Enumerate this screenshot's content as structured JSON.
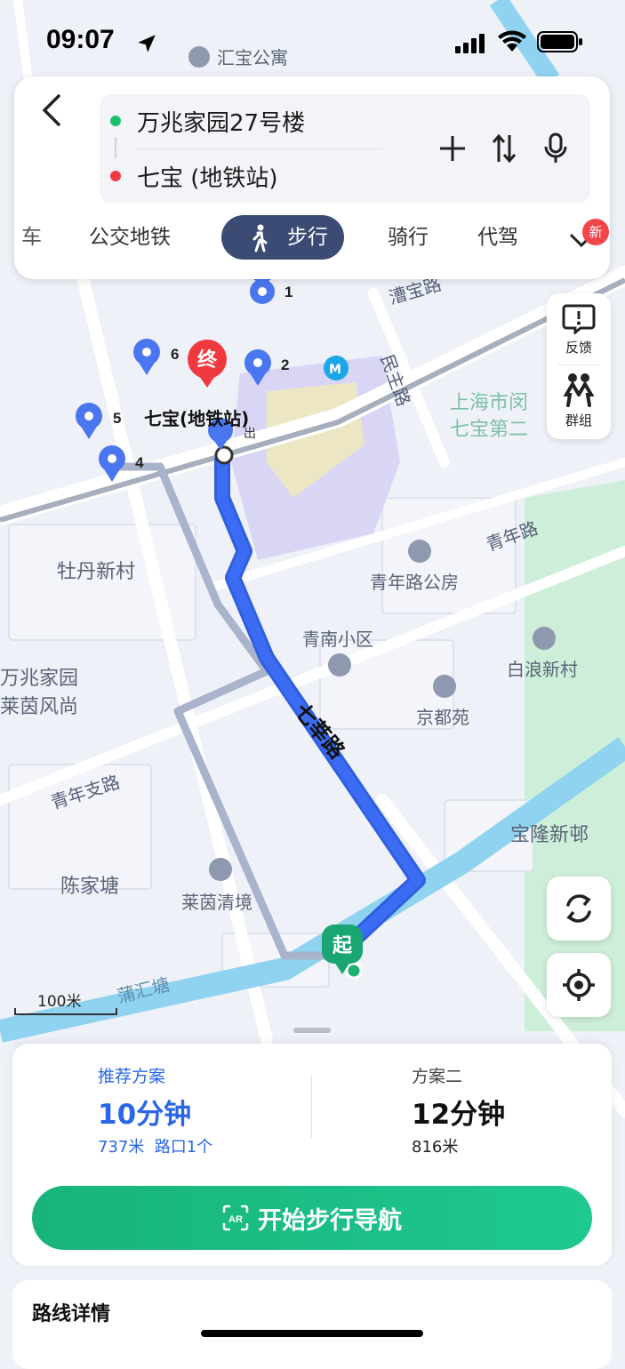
{
  "status_bar": {
    "time": "09:07"
  },
  "route": {
    "origin": "万兆家园27号楼",
    "destination": "七宝 (地铁站)"
  },
  "tabs": [
    "车",
    "公交地铁",
    "步行",
    "骑行",
    "代驾"
  ],
  "new_badge": "新",
  "side_panel": {
    "feedback": "反馈",
    "group": "群组"
  },
  "map": {
    "labels": {
      "huibao": "汇宝公寓",
      "caobao_road": "漕宝路",
      "minzhu_road": "民主路",
      "school1": "上海市闵",
      "school2": "七宝第二",
      "station": "七宝(地铁站)",
      "exit": "出",
      "mudan": "牡丹新村",
      "qingnian_road": "青年路",
      "qingnian_house": "青年路公房",
      "qingnan": "青南小区",
      "bailang": "白浪新村",
      "jingdu": "京都苑",
      "wanzhao1": "万兆家园",
      "wanzhao2": "莱茵风尚",
      "qixin_road": "七莘路",
      "qingnian_branch": "青年支路",
      "baolong": "宝隆新邨",
      "chenjiatang": "陈家塘",
      "laiyin": "莱茵清境",
      "puhui": "蒲汇塘",
      "end_marker": "终",
      "start_marker": "起"
    },
    "exits": [
      "1",
      "2",
      "4",
      "5",
      "6"
    ],
    "scale": "100米"
  },
  "plans": [
    {
      "label": "推荐方案",
      "time": "10分钟",
      "meta": "737米  路口1个"
    },
    {
      "label": "方案二",
      "time": "12分钟",
      "meta": "816米"
    }
  ],
  "start_nav": "开始步行导航",
  "route_details": "路线详情",
  "colors": {
    "route_blue": "#3b6cf3",
    "alt_route": "#a9b3cb",
    "accent_green": "#1bbf86",
    "tab_active": "#3b4b74"
  }
}
